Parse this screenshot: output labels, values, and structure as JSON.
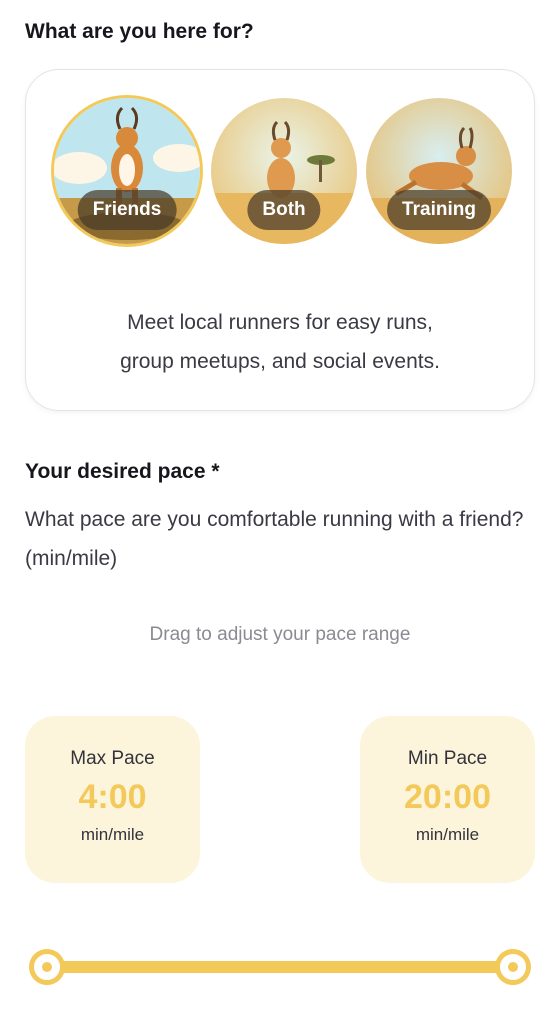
{
  "purpose": {
    "title": "What are you here for?",
    "options": [
      {
        "label": "Friends",
        "selected": true
      },
      {
        "label": "Both",
        "selected": false
      },
      {
        "label": "Training",
        "selected": false
      }
    ],
    "description_line1": "Meet local runners for easy runs,",
    "description_line2": "group meetups, and social events."
  },
  "pace": {
    "title": "Your desired pace *",
    "question": "What pace are you comfortable running with a friend? (min/mile)",
    "drag_hint": "Drag to adjust your pace range",
    "max": {
      "label": "Max Pace",
      "value": "4:00",
      "unit": "min/mile"
    },
    "min": {
      "label": "Min Pace",
      "value": "20:00",
      "unit": "min/mile"
    },
    "slider": {
      "range_start_fraction": 0.0,
      "range_end_fraction": 1.0
    }
  },
  "colors": {
    "accent": "#f3c95a",
    "card_bg": "#fdf4dc"
  }
}
